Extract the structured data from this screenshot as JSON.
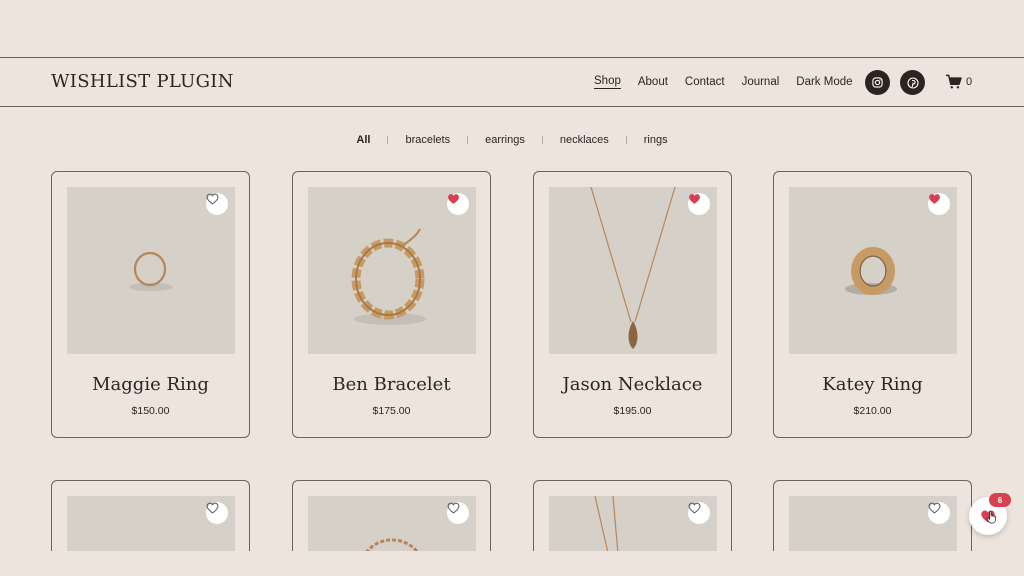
{
  "header": {
    "logo": "WISHLIST PLUGIN",
    "nav": [
      {
        "label": "Shop",
        "active": true
      },
      {
        "label": "About"
      },
      {
        "label": "Contact"
      },
      {
        "label": "Journal"
      },
      {
        "label": "Dark Mode"
      }
    ],
    "social": [
      {
        "icon": "instagram-icon"
      },
      {
        "icon": "pinterest-icon"
      }
    ],
    "cart_count": "0"
  },
  "filters": [
    {
      "label": "All",
      "active": true
    },
    {
      "label": "bracelets"
    },
    {
      "label": "earrings"
    },
    {
      "label": "necklaces"
    },
    {
      "label": "rings"
    }
  ],
  "products": [
    {
      "name": "Maggie Ring",
      "price": "$150.00",
      "wishlisted": false,
      "image": "ring-thin"
    },
    {
      "name": "Ben Bracelet",
      "price": "$175.00",
      "wishlisted": true,
      "image": "chain-bracelet"
    },
    {
      "name": "Jason Necklace",
      "price": "$195.00",
      "wishlisted": true,
      "image": "pendant-necklace"
    },
    {
      "name": "Katey Ring",
      "price": "$210.00",
      "wishlisted": true,
      "image": "ring-band"
    }
  ],
  "wishlist": {
    "count": "6"
  },
  "colors": {
    "background": "#ece4dd",
    "heart_active": "#d6404f",
    "border": "#6f625b",
    "image_bg": "#d5d1c9",
    "gold": "#c89a63"
  }
}
